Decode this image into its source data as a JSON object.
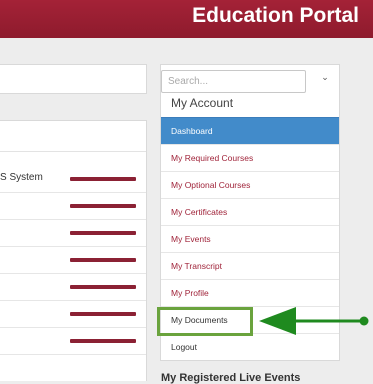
{
  "header": {
    "portal_title": "Education Portal",
    "brand_color": "#9b1f33"
  },
  "left_list": {
    "first_row_label": "S System",
    "bar_color": "#8b2134"
  },
  "search": {
    "placeholder": "Search...",
    "toggle_icon": "chevron-down-icon"
  },
  "account": {
    "title": "My Account",
    "items": [
      {
        "label": "Dashboard",
        "active": true
      },
      {
        "label": "My Required Courses"
      },
      {
        "label": "My Optional Courses"
      },
      {
        "label": "My Certificates"
      },
      {
        "label": "My Events"
      },
      {
        "label": "My Transcript"
      },
      {
        "label": "My Profile"
      },
      {
        "label": "My Documents",
        "highlighted": true
      },
      {
        "label": "Logout"
      }
    ],
    "active_color": "#428bca",
    "highlight_color": "#6aa33d",
    "arrow_color": "#1f8a1f"
  },
  "next_section": {
    "heading": "My Registered Live Events"
  }
}
